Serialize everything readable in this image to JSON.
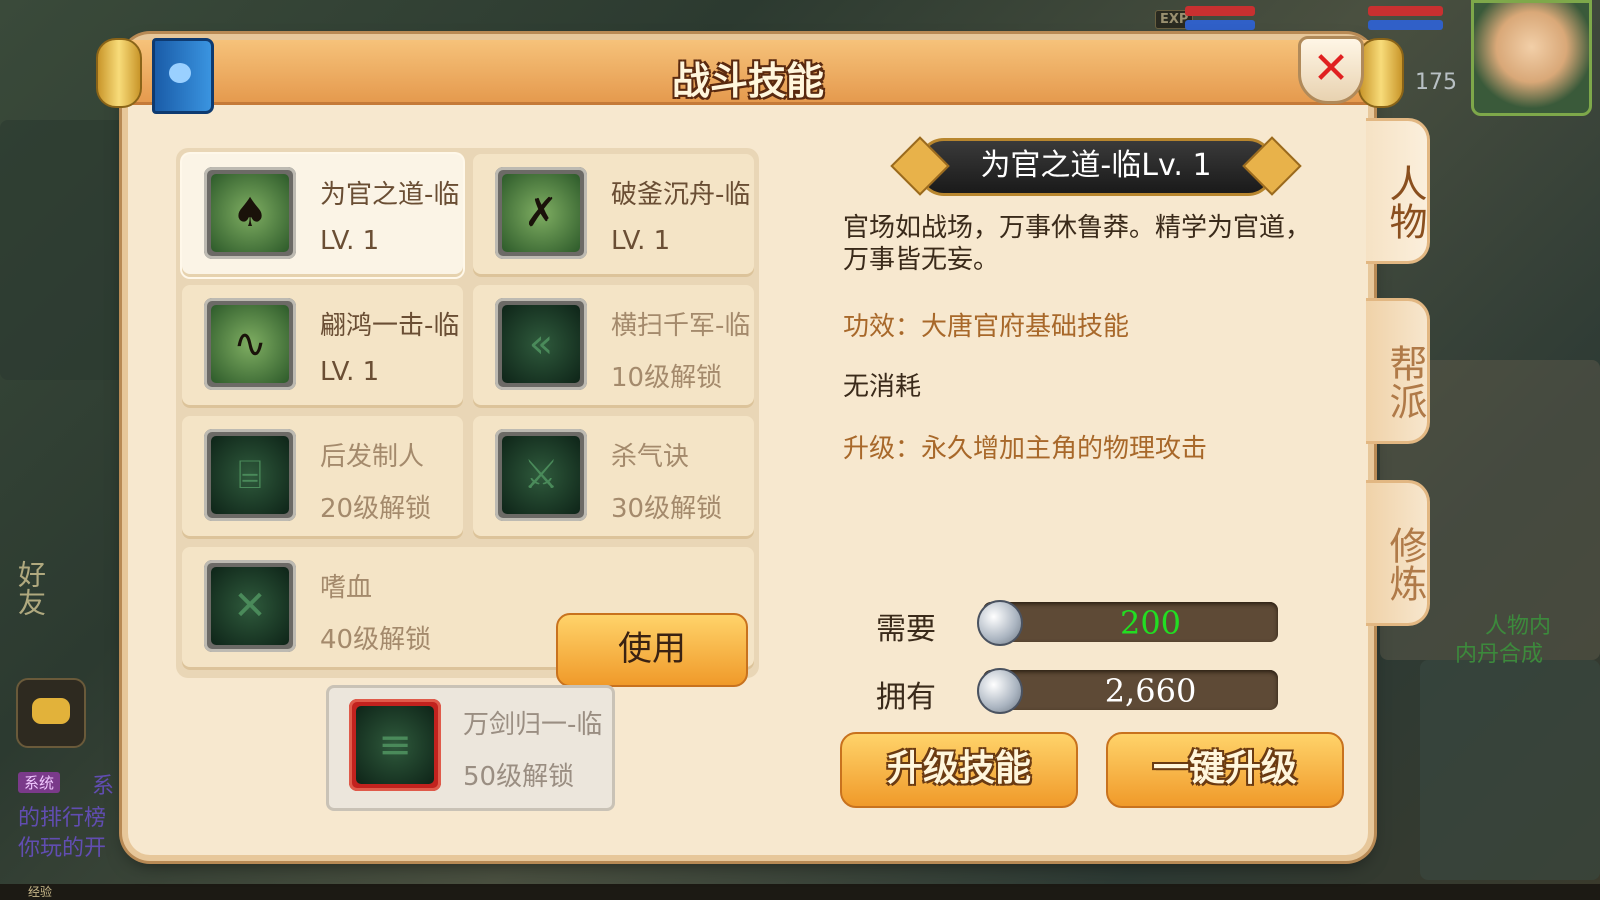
{
  "hud": {
    "exp_label": "EXP",
    "level": "175"
  },
  "chat": {
    "friend_label": "好友",
    "system_tag": "系统",
    "line1": "系",
    "line2": "的排行榜",
    "line3": "你玩的开",
    "bottom_label": "经验",
    "right_note1": "人物内",
    "right_note2": "内丹合成"
  },
  "panel": {
    "title": "战斗技能",
    "close_symbol": "✕"
  },
  "side_tabs": [
    "人物",
    "帮派",
    "修炼"
  ],
  "skills": [
    {
      "name": "为官之道-临",
      "status": "LV. 1",
      "icon": "twin-figures-icon"
    },
    {
      "name": "破釜沉舟-临",
      "status": "LV. 1",
      "icon": "crossed-blades-icon"
    },
    {
      "name": "翩鸿一击-临",
      "status": "LV. 1",
      "icon": "serpent-icon"
    },
    {
      "name": "横扫千军-临",
      "status": "10级解锁",
      "icon": "chevrons-icon"
    },
    {
      "name": "后发制人",
      "status": "20级解锁",
      "icon": "gate-icon"
    },
    {
      "name": "杀气诀",
      "status": "30级解锁",
      "icon": "sword-icon"
    },
    {
      "name": "嗜血",
      "status": "40级解锁",
      "icon": "running-man-icon"
    }
  ],
  "use_button": "使用",
  "ultimate": {
    "name": "万剑归一-临",
    "status": "50级解锁",
    "icon": "scroll-runes-icon"
  },
  "detail": {
    "title": "为官之道-临Lv. 1",
    "description": "官场如战场，万事休鲁莽。精学为官道，万事皆无妄。",
    "effect": "功效：大唐官府基础技能",
    "cost": "无消耗",
    "upgrade": "升级：永久增加主角的物理攻击"
  },
  "resources": {
    "need_label": "需要",
    "need_value": "200",
    "need_color": "#22dd22",
    "have_label": "拥有",
    "have_value": "2,660",
    "have_color": "#ffffff"
  },
  "buttons": {
    "upgrade": "升级技能",
    "upgrade_all": "一键升级"
  }
}
